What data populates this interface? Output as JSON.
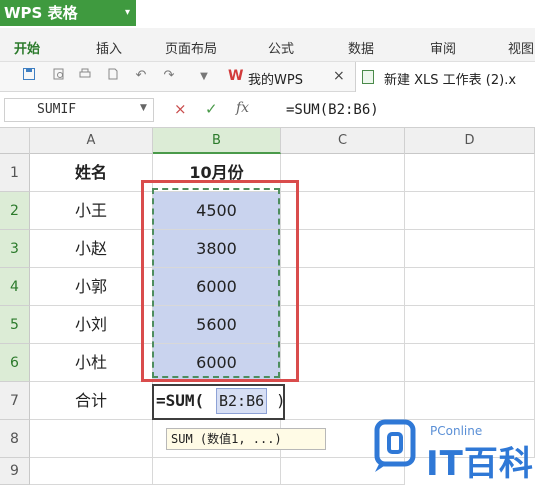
{
  "app": {
    "title": "WPS 表格",
    "accent": "#3f9a3f"
  },
  "ribbon": {
    "tabs": [
      {
        "label": "开始",
        "active": true
      },
      {
        "label": "插入"
      },
      {
        "label": "页面布局"
      },
      {
        "label": "公式"
      },
      {
        "label": "数据"
      },
      {
        "label": "审阅"
      },
      {
        "label": "视图"
      }
    ]
  },
  "quickbar": {
    "icons": [
      "save-icon",
      "print-preview-icon",
      "print-icon",
      "export-icon",
      "undo-icon",
      "redo-icon",
      "dropdown-icon"
    ],
    "tabs": [
      {
        "label": "我的WPS",
        "icon": "wps-logo-icon"
      },
      {
        "label": "新建 XLS 工作表 (2).x",
        "icon": "sheet-file-icon"
      }
    ]
  },
  "formula_bar": {
    "name_box": "SUMIF",
    "cancel_icon": "×",
    "confirm_icon": "✓",
    "fx_label": "fx",
    "formula": "=SUM(B2:B6)"
  },
  "sheet": {
    "columns": [
      "A",
      "B",
      "C",
      "D"
    ],
    "rows": [
      "1",
      "2",
      "3",
      "4",
      "5",
      "6",
      "7",
      "8",
      "9"
    ],
    "cells": {
      "A1": "姓名",
      "B1": "10月份",
      "A2": "小王",
      "B2": "4500",
      "A3": "小赵",
      "B3": "3800",
      "A4": "小郭",
      "B4": "6000",
      "A5": "小刘",
      "B5": "5600",
      "A6": "小杜",
      "B6": "6000",
      "A7": "合计"
    },
    "editing": {
      "prefix": "=SUM(",
      "range": "B2:B6",
      "suffix": ")"
    },
    "tooltip": "SUM (数值1, ...)"
  },
  "watermark": {
    "small": "PConline",
    "big": "IT百科",
    "color": "#2f78d6"
  }
}
